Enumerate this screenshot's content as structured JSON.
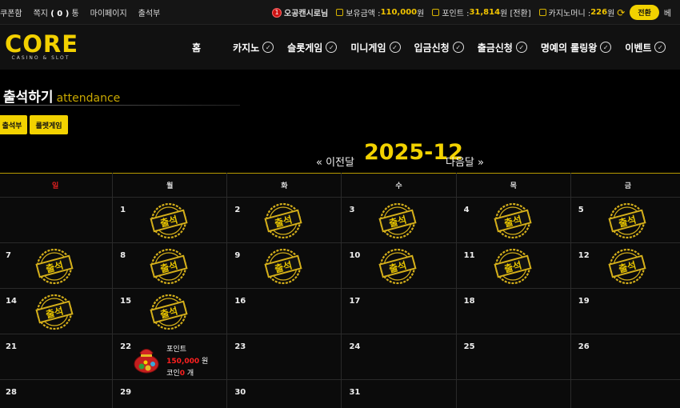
{
  "topbar": {
    "coupon": "쿠폰함",
    "memo_label": "쪽지",
    "memo_count": "( 0 )",
    "memo_suffix": "통",
    "mypage": "마이페이지",
    "attendance": "출석부",
    "level": "1",
    "username": "오공캔시로님",
    "balance_label": "보유금액 :",
    "balance_value": "110,000",
    "balance_unit": "원",
    "point_label": "포인트 :",
    "point_value": "31,814",
    "point_unit": "원 [전환]",
    "casino_money_label": "카지노머니 :",
    "casino_money_value": "226",
    "casino_money_unit": "원",
    "swap_button": "전환",
    "cut_text": "베"
  },
  "logo": {
    "word": "CORE",
    "sub": "CASINO & SLOT"
  },
  "nav": {
    "items": [
      {
        "label": "홈",
        "check": false
      },
      {
        "label": "카지노",
        "check": true
      },
      {
        "label": "슬롯게임",
        "check": true
      },
      {
        "label": "미니게임",
        "check": true
      },
      {
        "label": "입금신청",
        "check": true
      },
      {
        "label": "출금신청",
        "check": true
      },
      {
        "label": "명예의 롤링왕",
        "check": true
      },
      {
        "label": "이벤트",
        "check": true
      }
    ]
  },
  "page": {
    "title": "출석하기",
    "title_en": "attendance",
    "buttons": [
      "출석부",
      "룰렛게임"
    ]
  },
  "month": {
    "prev": "« 이전달",
    "label": "2025-12",
    "next": "다음달 »"
  },
  "calendar": {
    "weekdays": [
      "일",
      "월",
      "화",
      "수",
      "목",
      "금"
    ],
    "stamp_text": "출석",
    "weeks": [
      [
        {
          "day": ""
        },
        {
          "day": "1",
          "stamp": true
        },
        {
          "day": "2",
          "stamp": true
        },
        {
          "day": "3",
          "stamp": true
        },
        {
          "day": "4",
          "stamp": true
        },
        {
          "day": "5",
          "stamp": true
        }
      ],
      [
        {
          "day": "7",
          "stamp": true
        },
        {
          "day": "8",
          "stamp": true
        },
        {
          "day": "9",
          "stamp": true
        },
        {
          "day": "10",
          "stamp": true
        },
        {
          "day": "11",
          "stamp": true
        },
        {
          "day": "12",
          "stamp": true
        }
      ],
      [
        {
          "day": "14",
          "stamp": true
        },
        {
          "day": "15",
          "stamp": true
        },
        {
          "day": "16"
        },
        {
          "day": "17"
        },
        {
          "day": "18"
        },
        {
          "day": "19"
        }
      ],
      [
        {
          "day": "21"
        },
        {
          "day": "22",
          "reward": true
        },
        {
          "day": "23"
        },
        {
          "day": "24"
        },
        {
          "day": "25"
        },
        {
          "day": "26"
        }
      ],
      [
        {
          "day": "28"
        },
        {
          "day": "29"
        },
        {
          "day": "30"
        },
        {
          "day": "31"
        },
        {
          "day": ""
        },
        {
          "day": ""
        }
      ]
    ],
    "reward": {
      "line1": "포인트",
      "amount": "150,000",
      "amount_unit": " 원",
      "coin_label": "코인",
      "coin_count": "0",
      "coin_unit": " 개"
    }
  },
  "colors": {
    "accent": "#f2d200",
    "sunday": "#e02020"
  }
}
